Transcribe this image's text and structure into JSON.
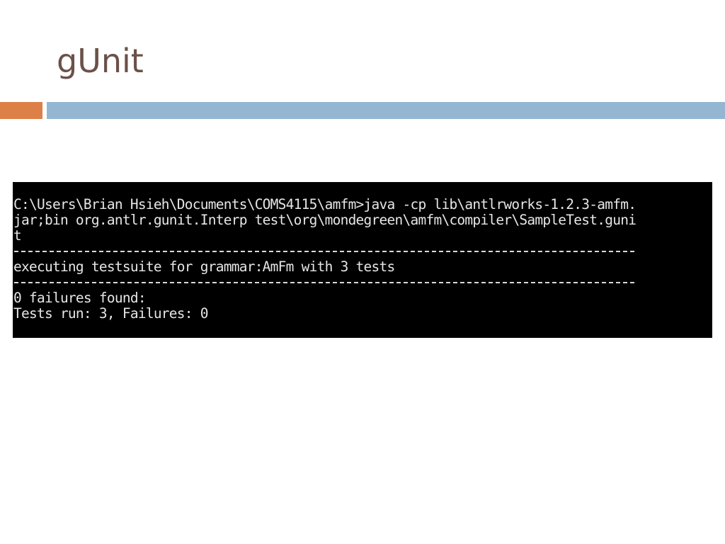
{
  "slide": {
    "title": "gUnit"
  },
  "console": {
    "lines": [
      "C:\\Users\\Brian Hsieh\\Documents\\COMS4115\\amfm>java -cp lib\\antlrworks-1.2.3-amfm.",
      "jar;bin org.antlr.gunit.Interp test\\org\\mondegreen\\amfm\\compiler\\SampleTest.guni",
      "t",
      "executing testsuite for grammar:AmFm with 3 tests",
      "0 failures found:",
      "Tests run: 3, Failures: 0"
    ]
  },
  "colors": {
    "title": "#6b5149",
    "accent_orange": "#dd8047",
    "accent_blue": "#94b6d2",
    "console_bg": "#000000",
    "console_text": "#e6e6e6"
  }
}
